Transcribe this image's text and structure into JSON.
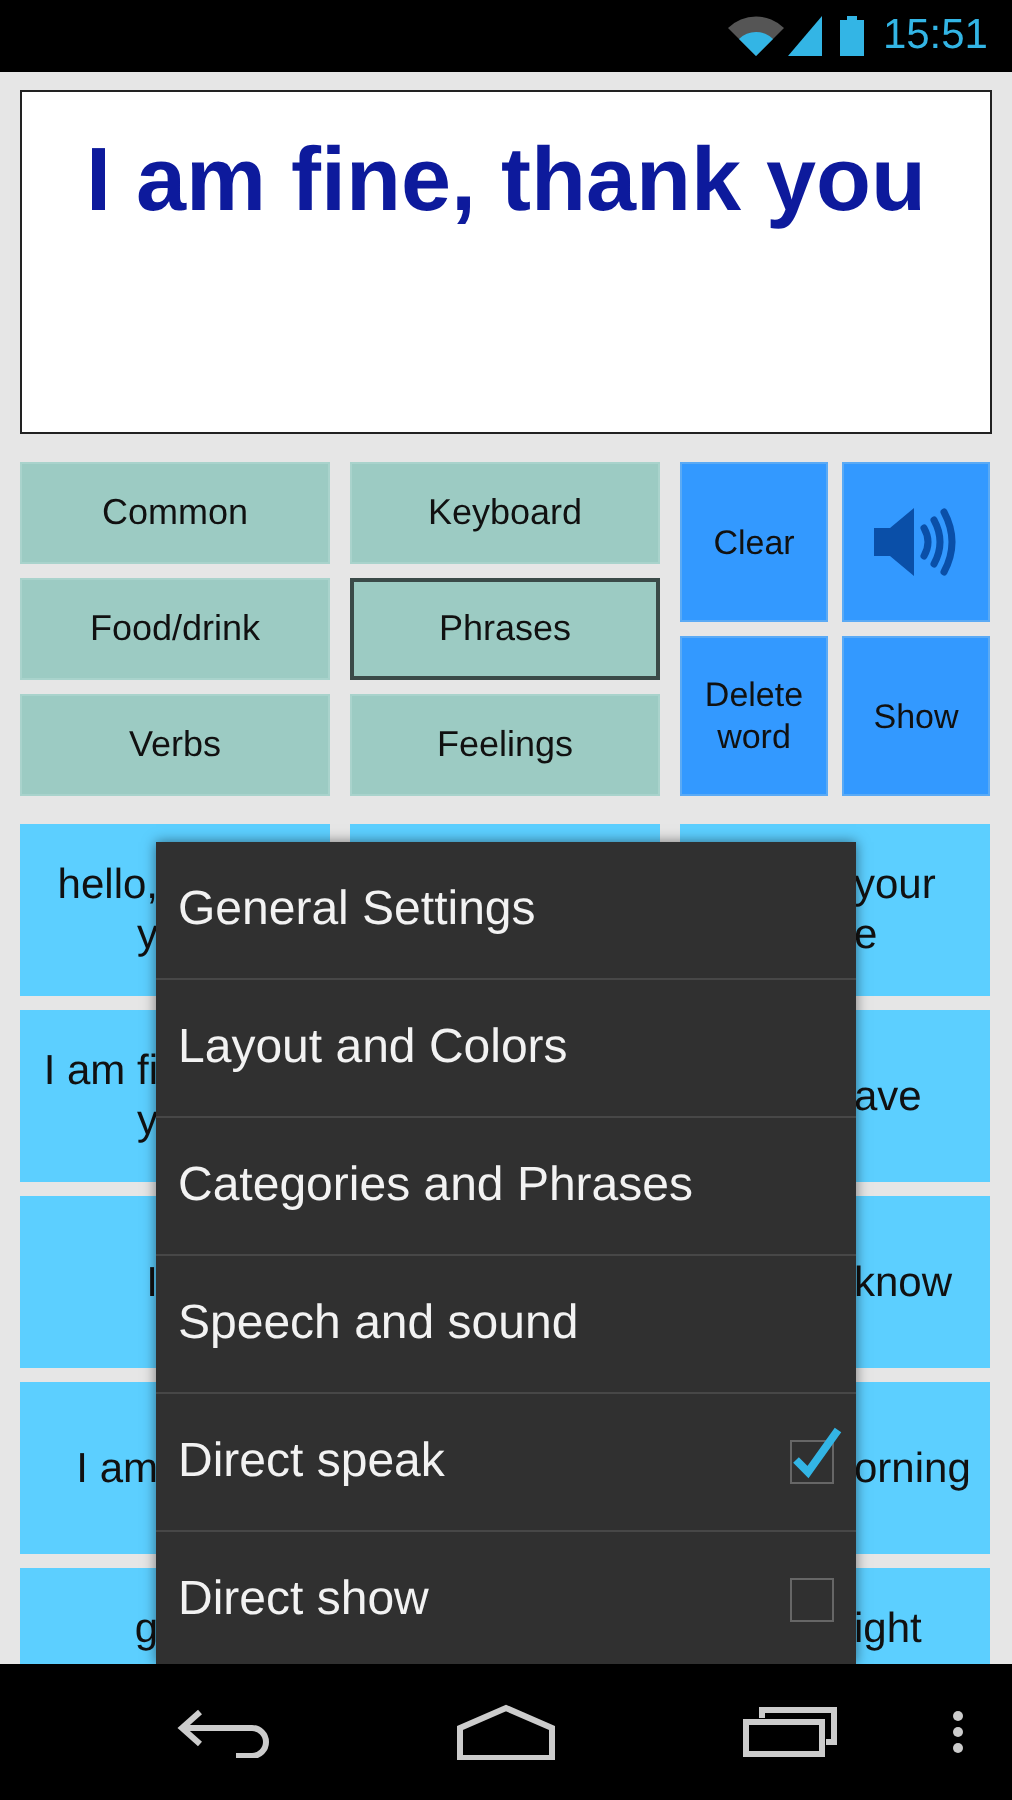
{
  "status_bar": {
    "time": "15:51"
  },
  "display": {
    "text": "I am fine, thank you"
  },
  "categories": [
    {
      "label": "Common",
      "selected": false
    },
    {
      "label": "Keyboard",
      "selected": false
    },
    {
      "label": "Food/drink",
      "selected": false
    },
    {
      "label": "Phrases",
      "selected": true
    },
    {
      "label": "Verbs",
      "selected": false
    },
    {
      "label": "Feelings",
      "selected": false
    }
  ],
  "actions": [
    {
      "kind": "text",
      "label": "Clear"
    },
    {
      "kind": "speaker"
    },
    {
      "kind": "text",
      "label": "Delete word"
    },
    {
      "kind": "text",
      "label": "Show"
    }
  ],
  "phrase_rows": [
    {
      "left": [
        "hello,",
        "y"
      ],
      "right": [
        "your",
        "e"
      ]
    },
    {
      "left": [
        "I am fi",
        "y"
      ],
      "right": [
        "ave"
      ]
    },
    {
      "left": [
        "I"
      ],
      "right": [
        "know"
      ]
    },
    {
      "left": [
        "I am"
      ],
      "right": [
        "orning"
      ]
    },
    {
      "left": [
        "g"
      ],
      "right": [
        "ight"
      ]
    }
  ],
  "menu": {
    "items": [
      {
        "kind": "plain",
        "label": "General Settings"
      },
      {
        "kind": "plain",
        "label": "Layout and Colors"
      },
      {
        "kind": "plain",
        "label": "Categories and Phrases"
      },
      {
        "kind": "plain",
        "label": "Speech and sound"
      },
      {
        "kind": "check",
        "label": "Direct speak",
        "checked": true
      },
      {
        "kind": "check",
        "label": "Direct show",
        "checked": false
      }
    ]
  }
}
